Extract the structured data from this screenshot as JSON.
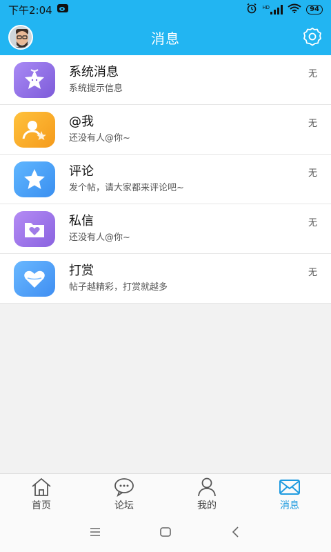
{
  "status": {
    "time": "下午2:04",
    "hd": "HD",
    "battery": "94"
  },
  "header": {
    "title": "消息"
  },
  "messages": [
    {
      "title": "系统消息",
      "subtitle": "系统提示信息",
      "state": "无",
      "icon": "star-mascot-icon",
      "color_from": "#a98af5",
      "color_to": "#7d5bd9"
    },
    {
      "title": "@我",
      "subtitle": "还没有人@你~",
      "state": "无",
      "icon": "user-star-icon",
      "color_from": "#ffc23d",
      "color_to": "#f59a1b"
    },
    {
      "title": "评论",
      "subtitle": "发个帖，请大家都来评论吧~",
      "state": "无",
      "icon": "star-bubble-icon",
      "color_from": "#5fb6ff",
      "color_to": "#3a8ff0"
    },
    {
      "title": "私信",
      "subtitle": "还没有人@你~",
      "state": "无",
      "icon": "heart-folder-icon",
      "color_from": "#b48bf4",
      "color_to": "#8a63e0"
    },
    {
      "title": "打赏",
      "subtitle": "帖子越精彩，打赏就越多",
      "state": "无",
      "icon": "heart-icon",
      "color_from": "#69b8ff",
      "color_to": "#3f8ef2"
    }
  ],
  "tabs": [
    {
      "label": "首页",
      "icon": "home-icon",
      "active": false
    },
    {
      "label": "论坛",
      "icon": "chat-bubble-icon",
      "active": false
    },
    {
      "label": "我的",
      "icon": "person-icon",
      "active": false
    },
    {
      "label": "消息",
      "icon": "envelope-icon",
      "active": true
    }
  ],
  "colors": {
    "accent": "#22b5f2",
    "active_tab": "#1f9be0"
  }
}
